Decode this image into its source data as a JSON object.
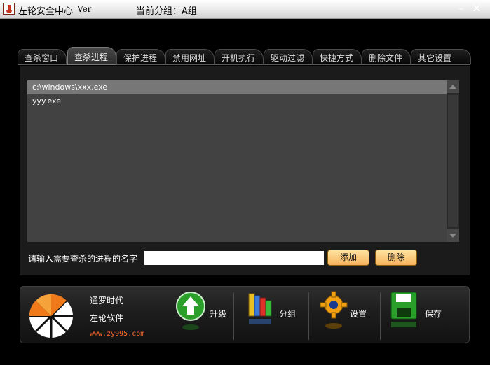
{
  "window": {
    "title": "左轮安全中心",
    "version": "Ver",
    "group": "当前分组：A组"
  },
  "tabs": [
    {
      "label": "查杀窗口",
      "active": false
    },
    {
      "label": "查杀进程",
      "active": true
    },
    {
      "label": "保护进程",
      "active": false
    },
    {
      "label": "禁用网址",
      "active": false
    },
    {
      "label": "开机执行",
      "active": false
    },
    {
      "label": "驱动过滤",
      "active": false
    },
    {
      "label": "快捷方式",
      "active": false
    },
    {
      "label": "删除文件",
      "active": false
    },
    {
      "label": "其它设置",
      "active": false
    }
  ],
  "process_list": {
    "items": [
      "c:\\windows\\xxx.exe",
      "yyy.exe"
    ],
    "selected_index": 0
  },
  "input": {
    "prompt": "请输入需要查杀的进程的名字",
    "value": "",
    "add_label": "添加",
    "delete_label": "删除"
  },
  "footer": {
    "brand_line1": "通罗时代",
    "brand_line2": "左轮软件",
    "website": "www.zy995.com",
    "tools": {
      "upgrade": "升级",
      "group": "分组",
      "settings": "设置",
      "save": "保存"
    }
  },
  "colors": {
    "accent_orange": "#f6b35c",
    "website_red": "#ff6a2a",
    "selection": "#777777"
  }
}
